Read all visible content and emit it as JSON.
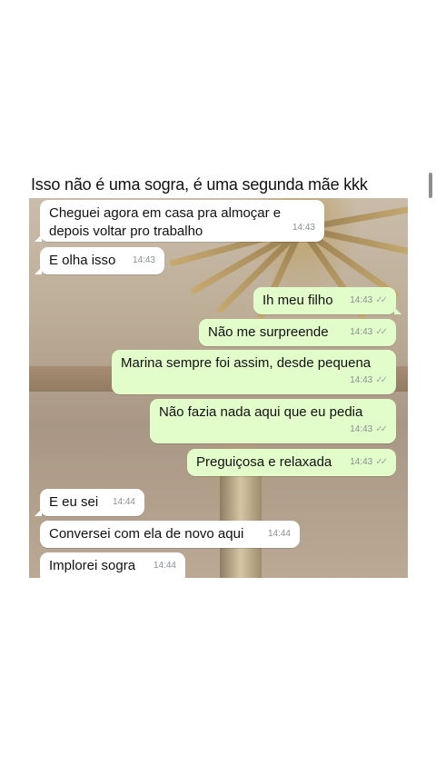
{
  "caption": "Isso não é uma sogra, é uma segunda mãe kkk",
  "messages": [
    {
      "dir": "in",
      "text_lines": [
        "Cheguei agora em casa pra almoçar e",
        "depois voltar pro trabalho"
      ],
      "time": "14:43"
    },
    {
      "dir": "in",
      "text": "E olha isso",
      "time": "14:43"
    },
    {
      "dir": "out",
      "text": "Ih meu filho",
      "time": "14:43",
      "status_icon": "double-check-icon"
    },
    {
      "dir": "out",
      "text": "Não me surpreende",
      "time": "14:43",
      "status_icon": "double-check-icon"
    },
    {
      "dir": "out",
      "text": "Marina sempre foi assim, desde pequena",
      "time": "14:43",
      "status_icon": "double-check-icon"
    },
    {
      "dir": "out",
      "text": "Não fazia nada aqui que eu pedia",
      "time": "14:43",
      "status_icon": "double-check-icon"
    },
    {
      "dir": "out",
      "text": "Preguiçosa e relaxada",
      "time": "14:43",
      "status_icon": "double-check-icon"
    },
    {
      "dir": "in",
      "text": "E eu sei",
      "time": "14:44"
    },
    {
      "dir": "in",
      "text": "Conversei com ela de novo aqui",
      "time": "14:44"
    },
    {
      "dir": "in",
      "text": "Implorei sogra",
      "time": "14:44"
    }
  ],
  "check_glyph": "✓✓",
  "colors": {
    "incoming_bubble": "#ffffff",
    "outgoing_bubble": "#e2fdca",
    "timestamp": "#8a8f93"
  }
}
